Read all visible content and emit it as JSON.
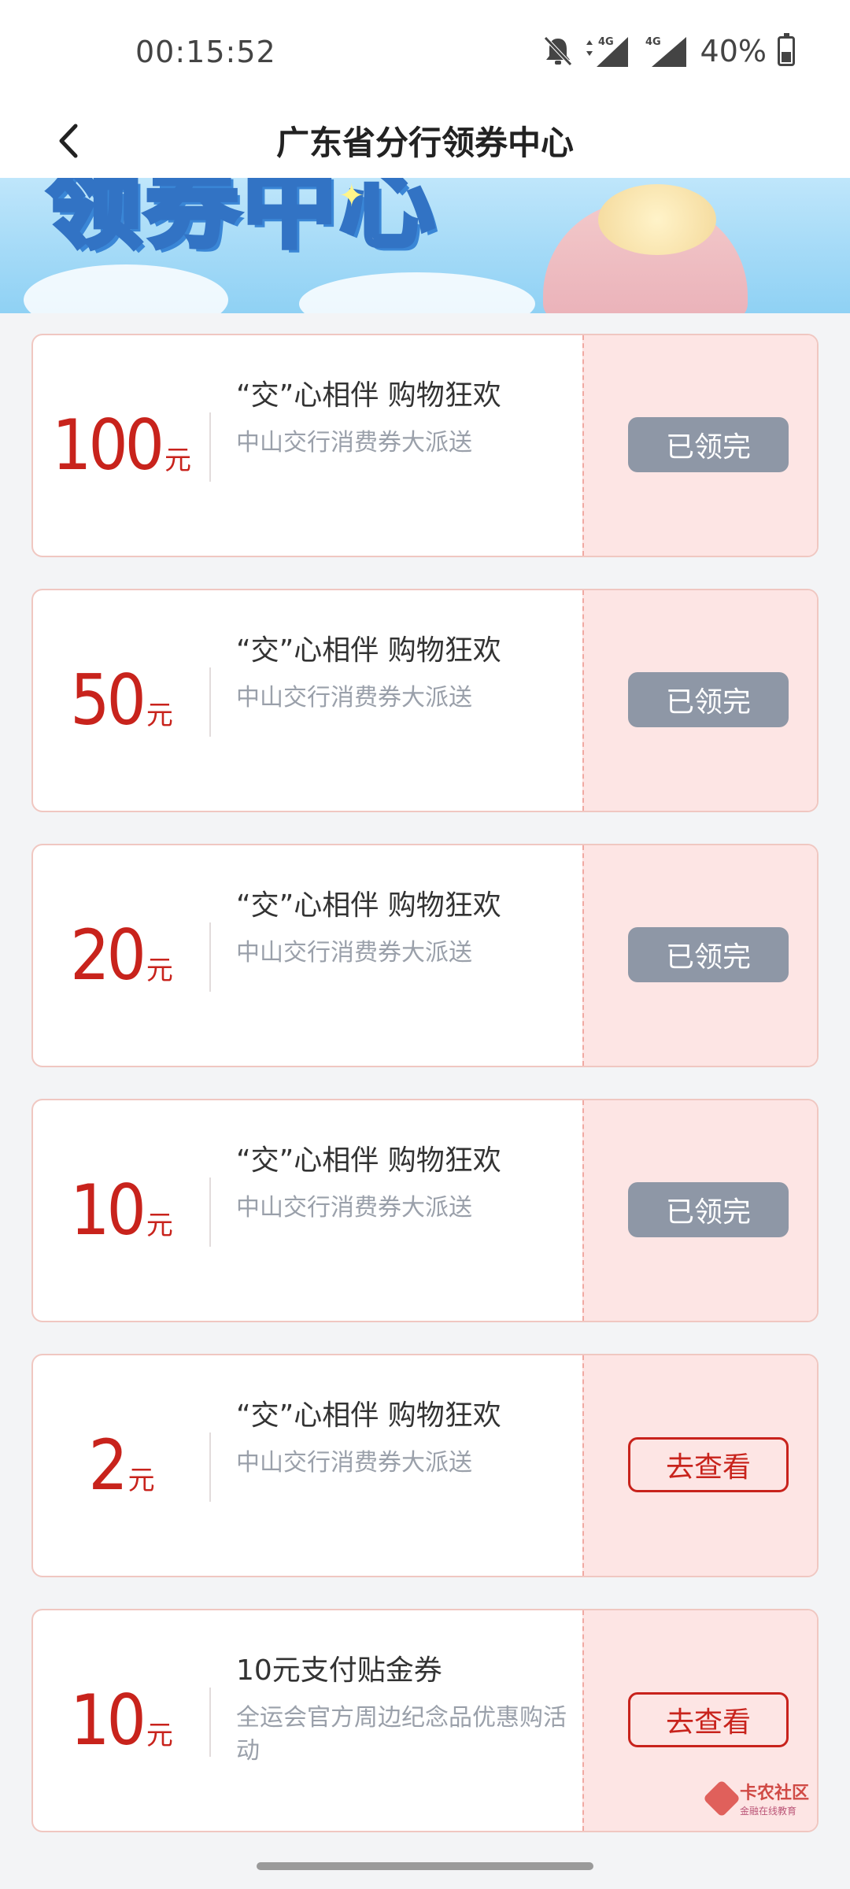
{
  "status_bar": {
    "time": "00:15:52",
    "network1": "4G",
    "network2": "4G",
    "battery": "40%"
  },
  "header": {
    "title": "广东省分行领券中心"
  },
  "banner": {
    "text": "领券中心"
  },
  "coupons": [
    {
      "amount": "100",
      "unit": "元",
      "title": "“交”心相伴 购物狂欢",
      "subtitle": "中山交行消费券大派送",
      "button": "已领完",
      "state": "disabled"
    },
    {
      "amount": "50",
      "unit": "元",
      "title": "“交”心相伴 购物狂欢",
      "subtitle": "中山交行消费券大派送",
      "button": "已领完",
      "state": "disabled"
    },
    {
      "amount": "20",
      "unit": "元",
      "title": "“交”心相伴 购物狂欢",
      "subtitle": "中山交行消费券大派送",
      "button": "已领完",
      "state": "disabled"
    },
    {
      "amount": "10",
      "unit": "元",
      "title": "“交”心相伴 购物狂欢",
      "subtitle": "中山交行消费券大派送",
      "button": "已领完",
      "state": "disabled"
    },
    {
      "amount": "2",
      "unit": "元",
      "title": "“交”心相伴 购物狂欢",
      "subtitle": "中山交行消费券大派送",
      "button": "去查看",
      "state": "active"
    },
    {
      "amount": "10",
      "unit": "元",
      "title": "10元支付贴金券",
      "subtitle": "全运会官方周边纪念品优惠购活动",
      "button": "去查看",
      "state": "active"
    }
  ],
  "watermark": {
    "title": "卡农社区",
    "subtitle": "金融在线教育"
  },
  "colors": {
    "accent": "#c8231c",
    "stub_bg": "#fde5e4",
    "disabled_btn": "#8e97a6"
  }
}
